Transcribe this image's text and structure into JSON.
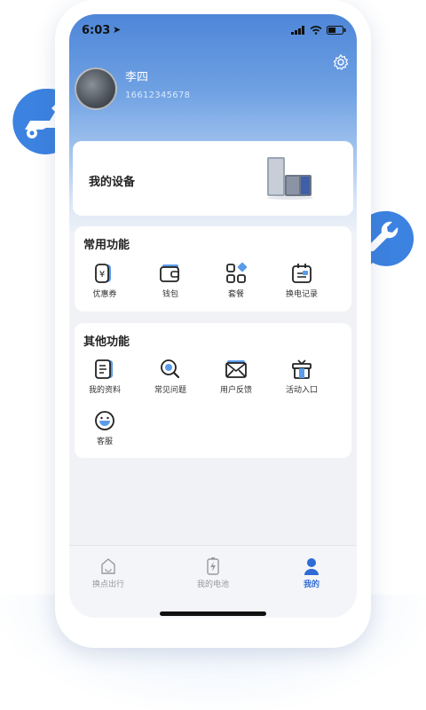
{
  "status_bar": {
    "time": "6:03"
  },
  "profile": {
    "name": "李四",
    "phone": "16612345678"
  },
  "device_card": {
    "title": "我的设备"
  },
  "common_functions": {
    "title": "常用功能",
    "items": [
      {
        "label": "优惠券",
        "icon": "coupon-icon"
      },
      {
        "label": "钱包",
        "icon": "wallet-icon"
      },
      {
        "label": "套餐",
        "icon": "package-icon"
      },
      {
        "label": "换电记录",
        "icon": "swap-record-icon"
      }
    ]
  },
  "other_functions": {
    "title": "其他功能",
    "items": [
      {
        "label": "我的资料",
        "icon": "profile-doc-icon"
      },
      {
        "label": "常见问题",
        "icon": "faq-search-icon"
      },
      {
        "label": "用户反馈",
        "icon": "feedback-mail-icon"
      },
      {
        "label": "活动入口",
        "icon": "gift-icon"
      },
      {
        "label": "客服",
        "icon": "customer-service-icon"
      }
    ]
  },
  "tabbar": {
    "tabs": [
      {
        "label": "换点出行",
        "icon": "home-icon",
        "active": false
      },
      {
        "label": "我的电池",
        "icon": "battery-icon",
        "active": false
      },
      {
        "label": "我的",
        "icon": "person-icon",
        "active": true
      }
    ]
  },
  "colors": {
    "accent": "#2f6bd4",
    "header_blue": "#4e86d8",
    "bubble_blue": "#3c82e0"
  }
}
